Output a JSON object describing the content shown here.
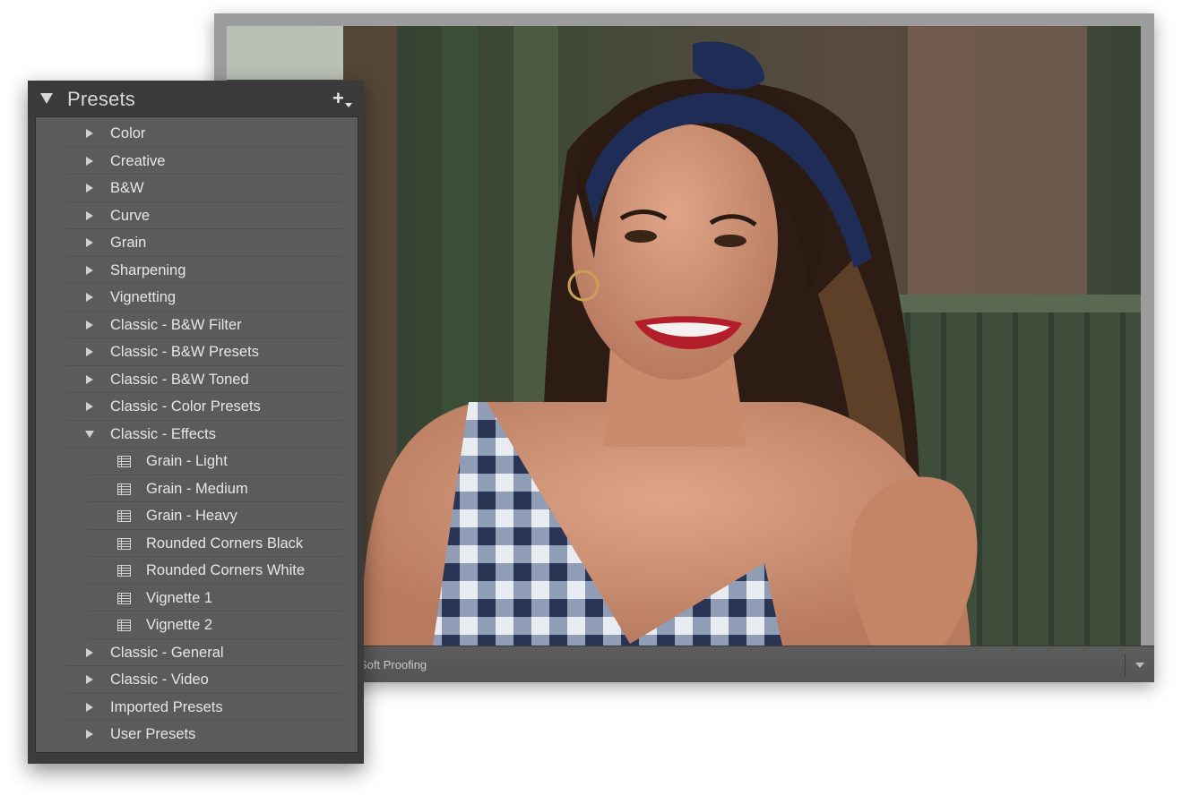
{
  "panel": {
    "title": "Presets",
    "add_icon": "plus-icon",
    "collapse_icon": "triangle-down-icon"
  },
  "groups": [
    {
      "label": "Color",
      "expanded": false
    },
    {
      "label": "Creative",
      "expanded": false
    },
    {
      "label": "B&W",
      "expanded": false
    },
    {
      "label": "Curve",
      "expanded": false
    },
    {
      "label": "Grain",
      "expanded": false
    },
    {
      "label": "Sharpening",
      "expanded": false
    },
    {
      "label": "Vignetting",
      "expanded": false
    },
    {
      "label": "Classic - B&W Filter",
      "expanded": false
    },
    {
      "label": "Classic - B&W Presets",
      "expanded": false
    },
    {
      "label": "Classic - B&W Toned",
      "expanded": false
    },
    {
      "label": "Classic - Color Presets",
      "expanded": false
    },
    {
      "label": "Classic - Effects",
      "expanded": true,
      "presets": [
        "Grain - Light",
        "Grain - Medium",
        "Grain - Heavy",
        "Rounded Corners Black",
        "Rounded Corners White",
        "Vignette 1",
        "Vignette 2"
      ]
    },
    {
      "label": "Classic - General",
      "expanded": false
    },
    {
      "label": "Classic - Video",
      "expanded": false
    },
    {
      "label": "Imported Presets",
      "expanded": false
    },
    {
      "label": "User Presets",
      "expanded": false
    }
  ],
  "toolbar": {
    "soft_proofing_label": "Soft Proofing",
    "menu_icon": "chevron-down-icon"
  },
  "colors": {
    "panel_bg": "#3c3c3c",
    "list_bg": "#5b5b5b",
    "text": "#e6e6e6",
    "frame": "#9c9c9c"
  }
}
